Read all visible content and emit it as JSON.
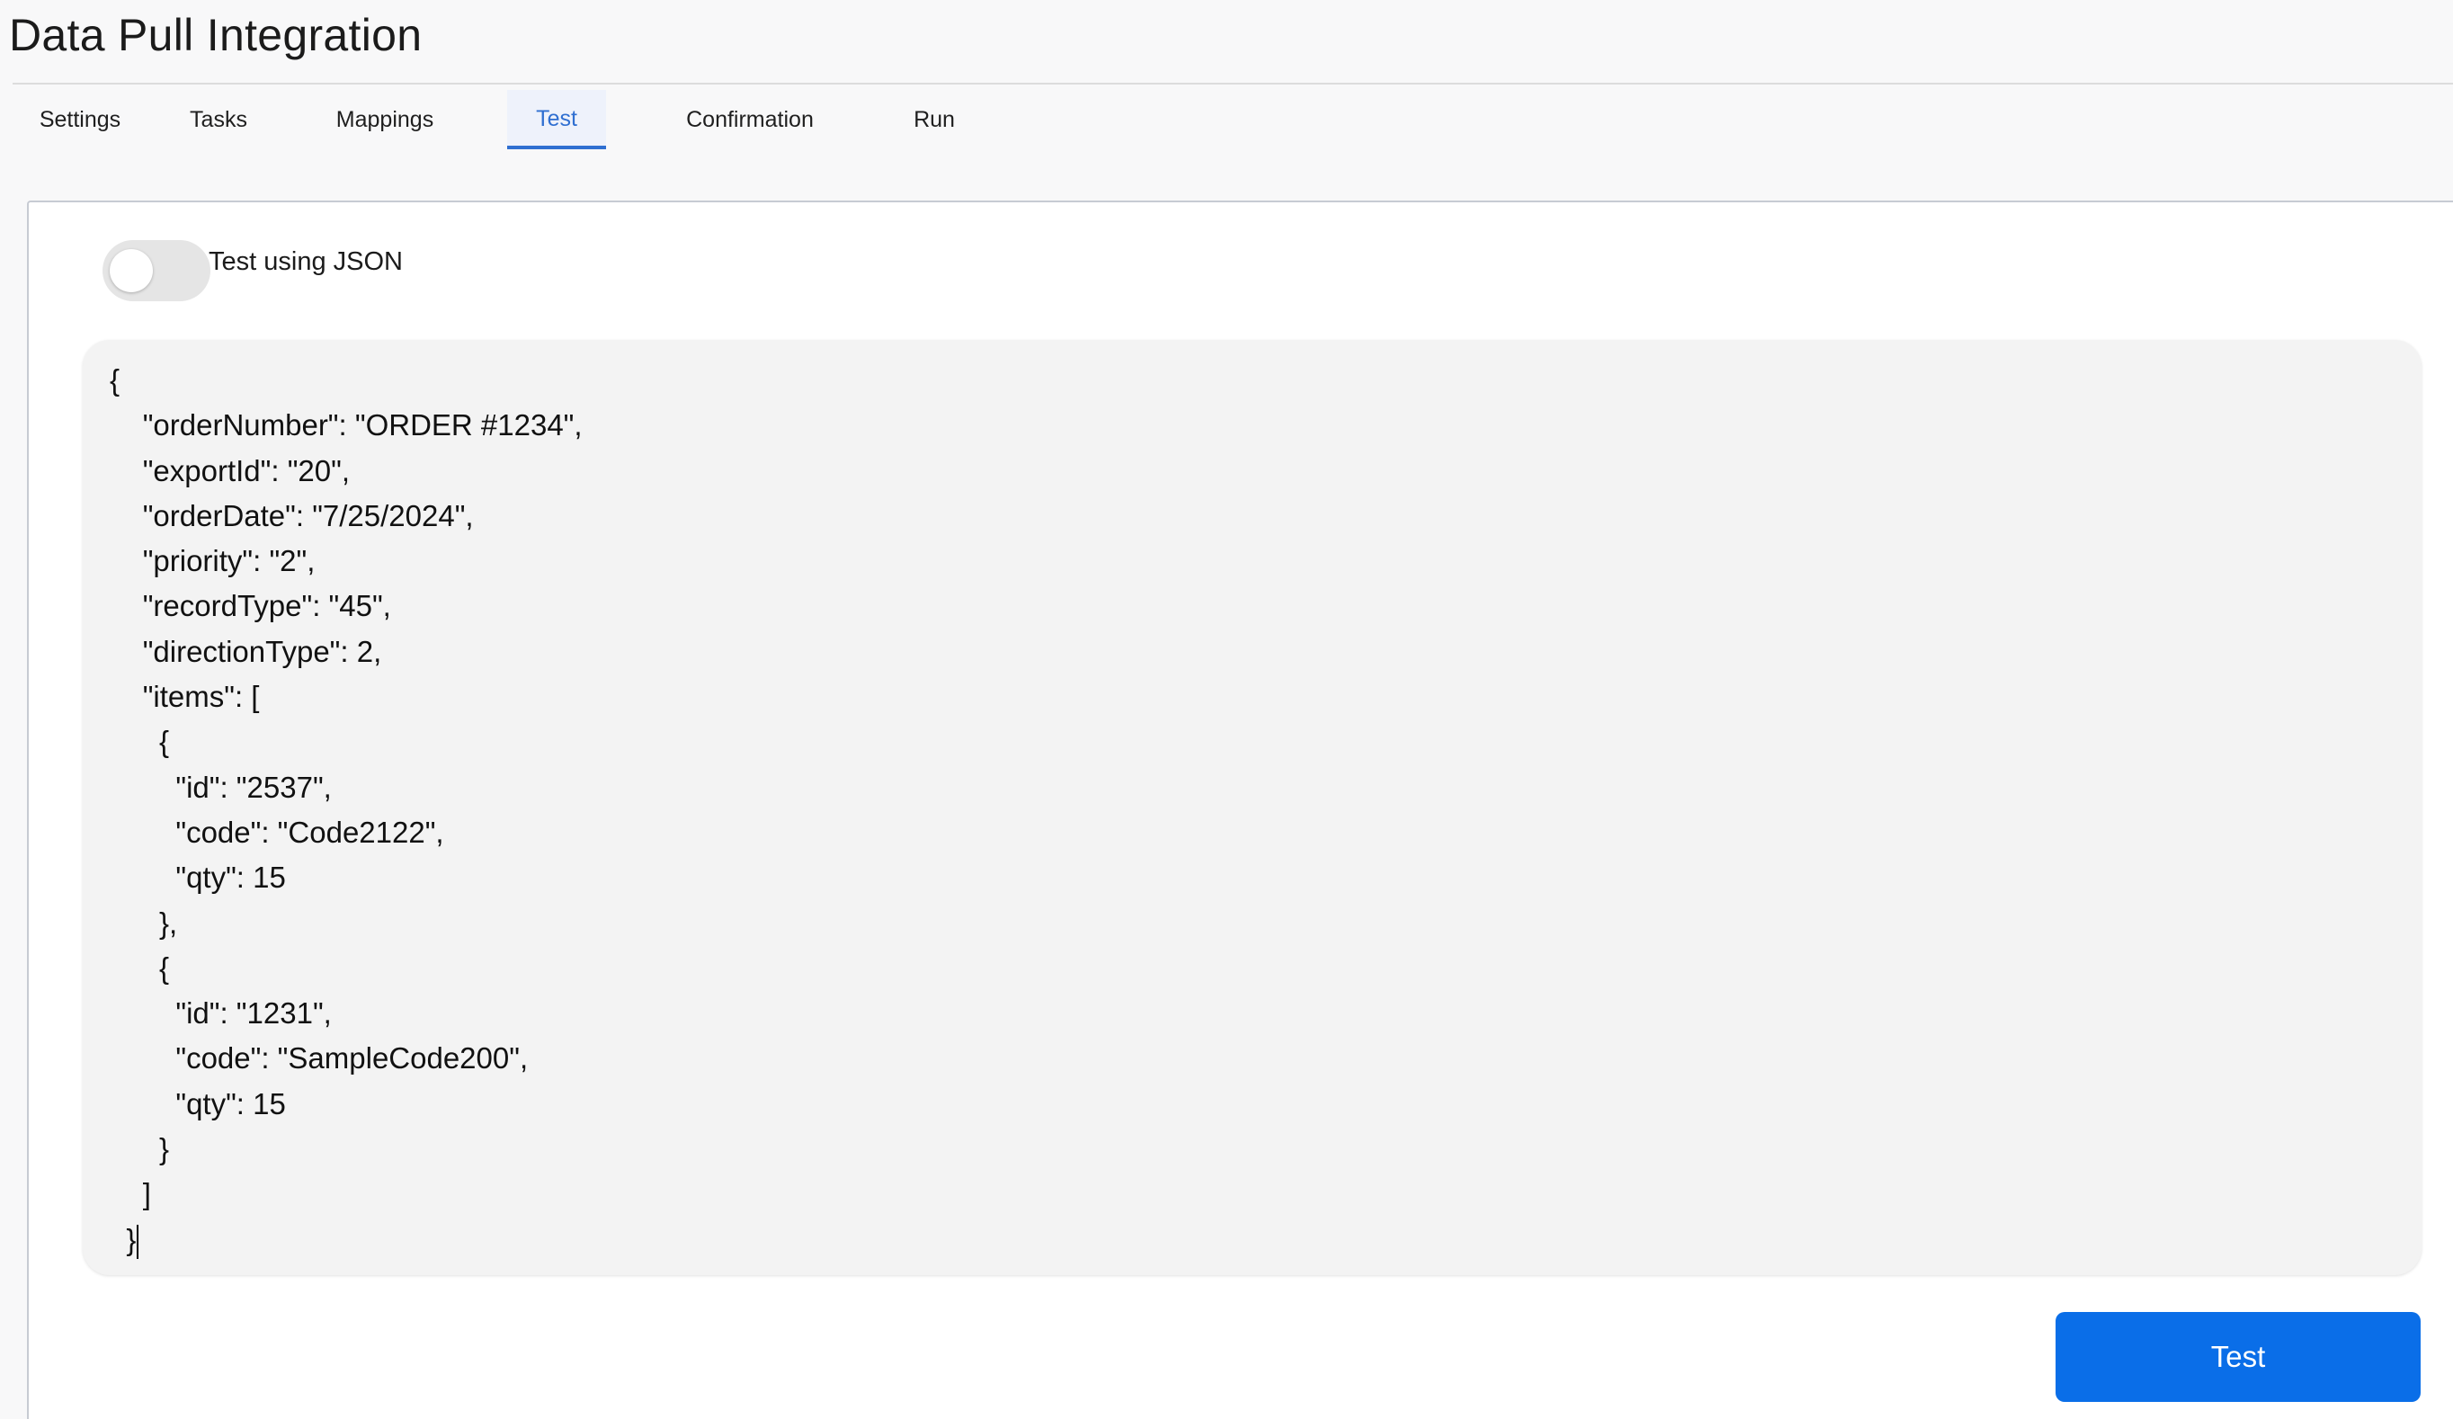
{
  "page": {
    "title": "Data Pull Integration"
  },
  "tabs": [
    {
      "label": "Settings",
      "active": false
    },
    {
      "label": "Tasks",
      "active": false
    },
    {
      "label": "Mappings",
      "active": false
    },
    {
      "label": "Test",
      "active": true
    },
    {
      "label": "Confirmation",
      "active": false
    },
    {
      "label": "Run",
      "active": false
    }
  ],
  "toggle": {
    "label": "Test using JSON",
    "checked": false
  },
  "editor": {
    "content": "{\n\t\"orderNumber\": \"ORDER #1234\",\n\t\"exportId\": \"20\",\n\t\"orderDate\": \"7/25/2024\",\n\t\"priority\": \"2\",\n\t\"recordType\": \"45\",\n\t\"directionType\": 2,\n\t\"items\": [\n\t  {\n\t    \"id\": \"2537\",\n\t    \"code\": \"Code2122\",\n\t    \"qty\": 15\n\t  },\n\t  {\n\t    \"id\": \"1231\",\n\t    \"code\": \"SampleCode200\",\n\t    \"qty\": 15\n\t  }\n\t]\n  }"
  },
  "actions": {
    "test_label": "Test"
  },
  "colors": {
    "accent": "#2f6fd1",
    "button": "#0a6ee8",
    "editor_bg": "#f3f3f3"
  }
}
